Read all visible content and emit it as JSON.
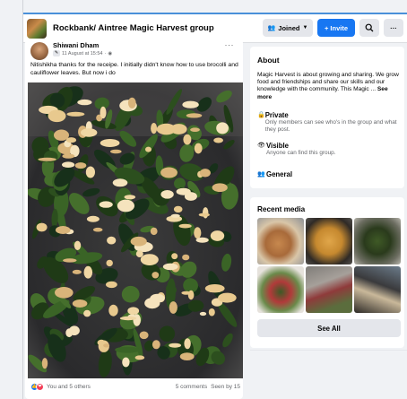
{
  "header": {
    "group_title": "Rockbank/ Aintree Magic Harvest group",
    "joined_label": "Joined",
    "invite_label": "+ Invite",
    "more_label": "···"
  },
  "post": {
    "author": "Shiwani Dham",
    "date": "11 August at 15:54",
    "more_label": "···",
    "text": "Nitishikha thanks for the receipe. I initially didn't know how to use brocolli and cauliflower leaves. But now i do",
    "reactions_label": "You and 5 others",
    "comments_label": "5 comments",
    "seen_label": "Seen by 15"
  },
  "about": {
    "title": "About",
    "description": "Magic Harvest is about growing and sharing. We grow food and friendships and share our skills and our knowledge with the community. This Magic ...",
    "see_more": "See more",
    "private_title": "Private",
    "private_sub": "Only members can see who's in the group and what they post.",
    "visible_title": "Visible",
    "visible_sub": "Anyone can find this group.",
    "general_title": "General"
  },
  "media": {
    "title": "Recent media",
    "see_all": "See All"
  },
  "colors": {
    "accent": "#1877f2",
    "page_bg": "#f0f2f5",
    "card_bg": "#ffffff",
    "secondary_text": "#65676b"
  },
  "icons": {
    "joined": "people-icon",
    "search": "search-icon",
    "private": "lock-icon",
    "visible": "eye-icon",
    "general": "group-icon",
    "audience": "friends-icon"
  }
}
